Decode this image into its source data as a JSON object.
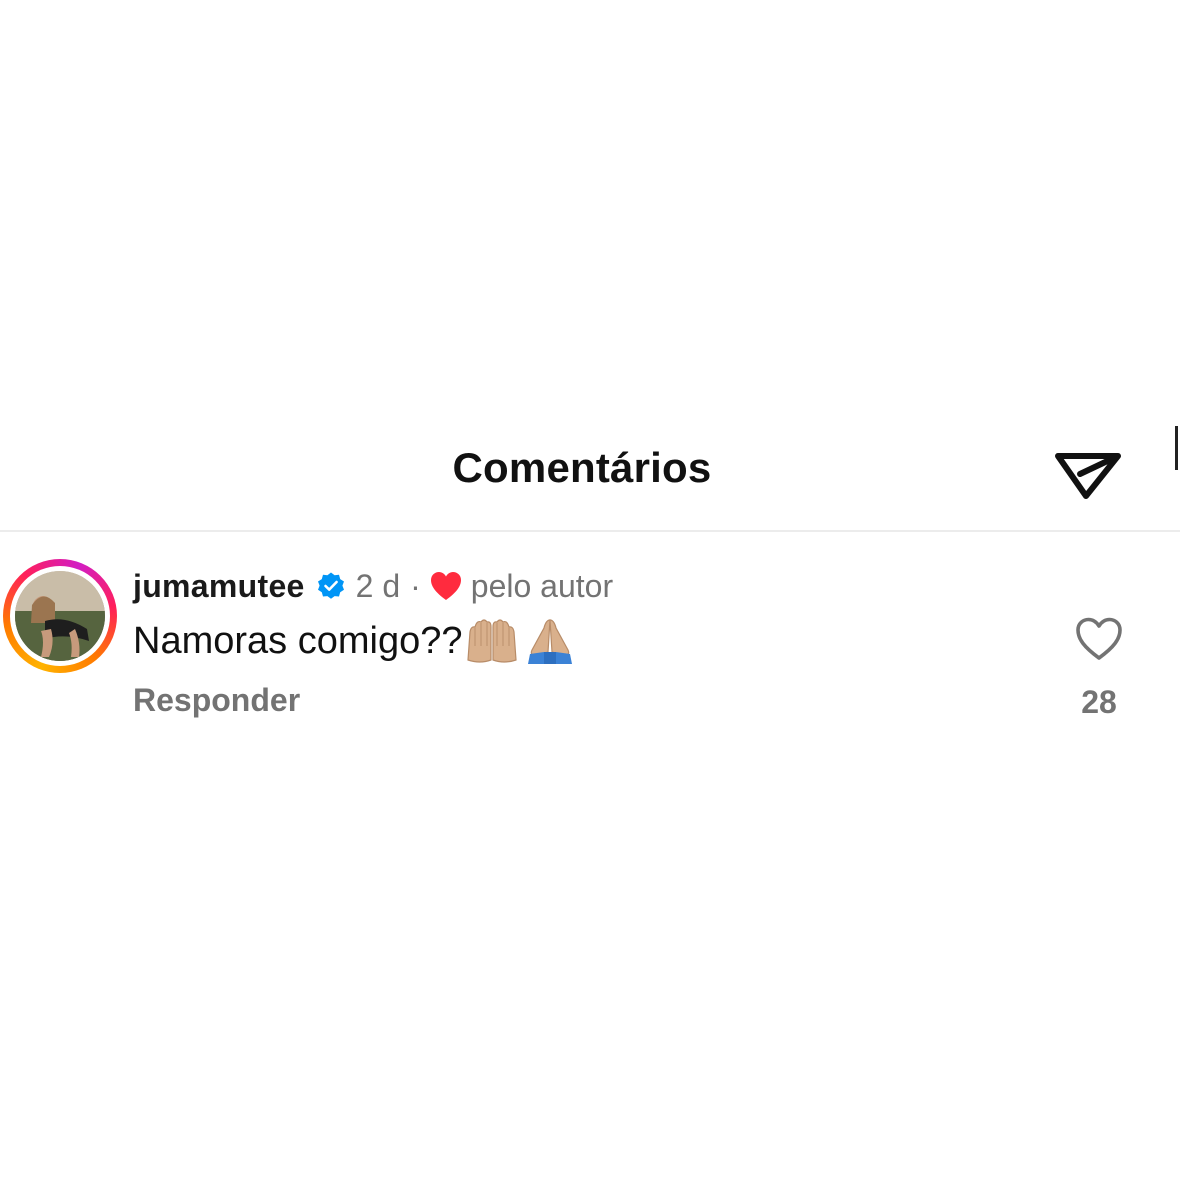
{
  "header": {
    "title": "Comentários",
    "share_icon": "send-icon"
  },
  "comment": {
    "username": "jumamutee",
    "verified_icon": "verified-badge-icon",
    "time": "2 d",
    "separator": "·",
    "liked_by_author_icon": "heart-filled-icon",
    "liked_by_author_text": "pelo autor",
    "text": "Namoras comigo??",
    "emojis": [
      "palms-up-together-icon",
      "folded-hands-icon"
    ],
    "reply_label": "Responder",
    "like_icon": "heart-outline-icon",
    "like_count": "28"
  },
  "colors": {
    "verified": "#0095f6",
    "heart": "#ff2b3e",
    "meta_gray": "#737373",
    "ring_start": "#ffb300",
    "ring_end": "#d21ec4"
  }
}
